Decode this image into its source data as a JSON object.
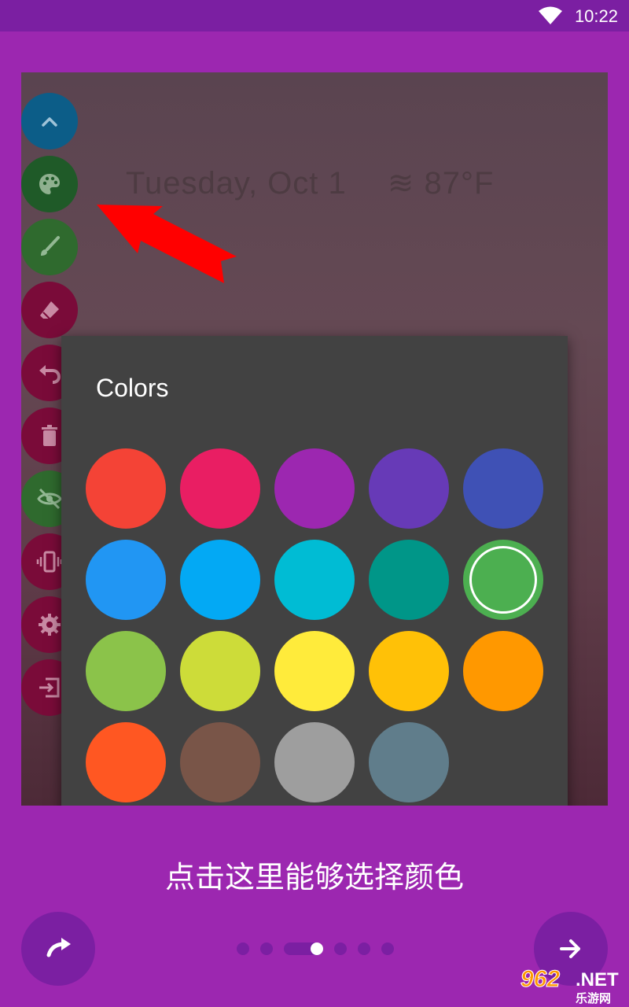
{
  "status_bar": {
    "time": "10:22",
    "wifi_icon": "wifi-icon"
  },
  "preview": {
    "date_text": "Tuesday, Oct 1",
    "weather_icon": "haze-icon",
    "temperature": "87°F",
    "toolbar": [
      {
        "name": "collapse-button",
        "icon": "chevron-up-icon",
        "color": "#0c5d88"
      },
      {
        "name": "palette-button",
        "icon": "palette-icon",
        "color": "#1f5a28"
      },
      {
        "name": "brush-button",
        "icon": "brush-icon",
        "color": "#2f6a2e"
      },
      {
        "name": "eraser-button",
        "icon": "eraser-icon",
        "color": "#7a0b39"
      },
      {
        "name": "undo-button",
        "icon": "undo-icon",
        "color": "#7a0b39"
      },
      {
        "name": "delete-button",
        "icon": "trash-icon",
        "color": "#7a0b39"
      },
      {
        "name": "hide-button",
        "icon": "eye-off-icon",
        "color": "#2f6a2e"
      },
      {
        "name": "vibrate-button",
        "icon": "vibrate-icon",
        "color": "#7a0b39"
      },
      {
        "name": "settings-button",
        "icon": "gear-icon",
        "color": "#7a0b39"
      },
      {
        "name": "exit-button",
        "icon": "exit-icon",
        "color": "#7a0b39"
      }
    ],
    "arrow_color": "#ff0000"
  },
  "colors_dialog": {
    "title": "Colors",
    "swatches": [
      {
        "color": "#f44336",
        "selected": false
      },
      {
        "color": "#e91e63",
        "selected": false
      },
      {
        "color": "#9c27b0",
        "selected": false
      },
      {
        "color": "#673ab7",
        "selected": false
      },
      {
        "color": "#3f51b5",
        "selected": false
      },
      {
        "color": "#2196f3",
        "selected": false
      },
      {
        "color": "#03a9f4",
        "selected": false
      },
      {
        "color": "#00bcd4",
        "selected": false
      },
      {
        "color": "#009688",
        "selected": false
      },
      {
        "color": "#4caf50",
        "selected": true
      },
      {
        "color": "#8bc34a",
        "selected": false
      },
      {
        "color": "#cddc39",
        "selected": false
      },
      {
        "color": "#ffeb3b",
        "selected": false
      },
      {
        "color": "#ffc107",
        "selected": false
      },
      {
        "color": "#ff9800",
        "selected": false
      },
      {
        "color": "#ff5722",
        "selected": false
      },
      {
        "color": "#795548",
        "selected": false
      },
      {
        "color": "#9e9e9e",
        "selected": false
      },
      {
        "color": "#607d8b",
        "selected": false
      }
    ]
  },
  "hint_text": "点击这里能够选择颜色",
  "navigation": {
    "back_icon": "redo-icon",
    "next_icon": "arrow-right-icon",
    "page_count": 7,
    "current_page": 3
  },
  "watermark": {
    "main": "962",
    "net": ".NET",
    "sub": "乐游网"
  },
  "theme": {
    "background": "#9c27b0",
    "dark": "#7b1fa2"
  }
}
